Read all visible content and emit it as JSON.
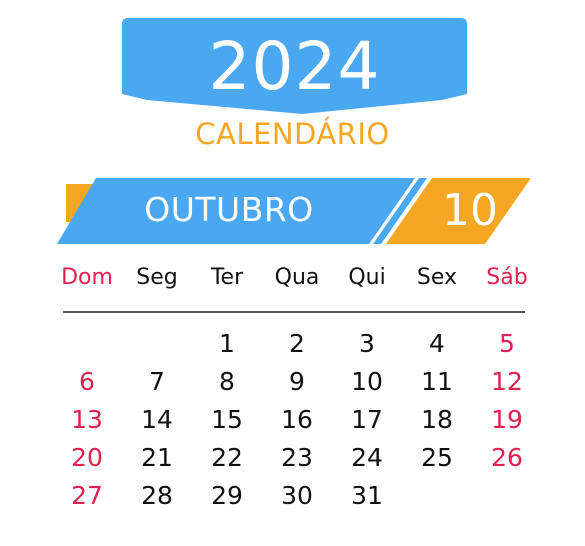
{
  "header": {
    "year": "2024",
    "subtitle": "CALENDÁRIO"
  },
  "month": {
    "name": "OUTUBRO",
    "number": "10"
  },
  "weekdays": [
    "Dom",
    "Seg",
    "Ter",
    "Qua",
    "Qui",
    "Sex",
    "Sáb"
  ],
  "weeks": [
    [
      "",
      "",
      "1",
      "2",
      "3",
      "4",
      "5"
    ],
    [
      "6",
      "7",
      "8",
      "9",
      "10",
      "11",
      "12"
    ],
    [
      "13",
      "14",
      "15",
      "16",
      "17",
      "18",
      "19"
    ],
    [
      "20",
      "21",
      "22",
      "23",
      "24",
      "25",
      "26"
    ],
    [
      "27",
      "28",
      "29",
      "30",
      "31",
      "",
      ""
    ]
  ],
  "colors": {
    "blue": "#4aa8f0",
    "orange": "#f5a623",
    "weekend_red": "#e0204f"
  }
}
